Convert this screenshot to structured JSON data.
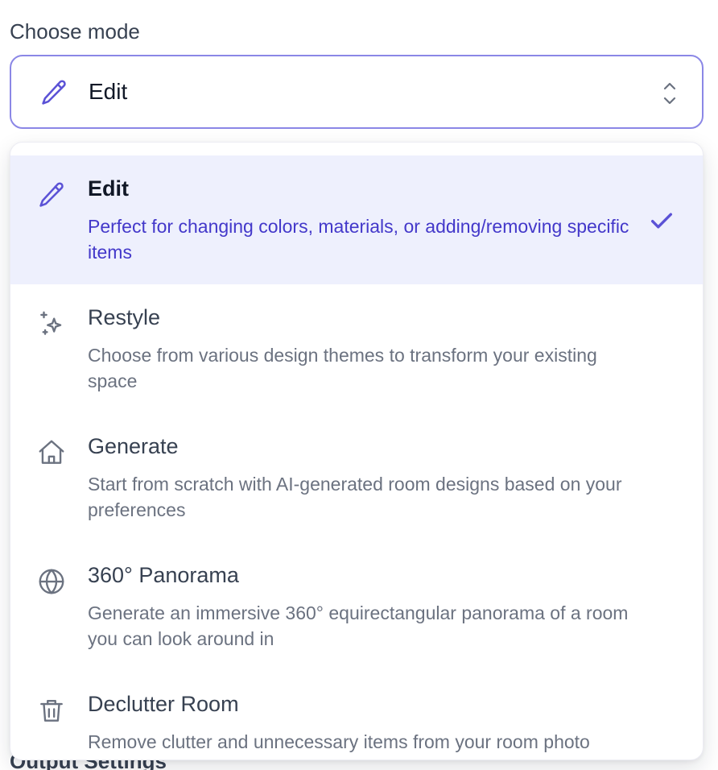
{
  "section_label": "Choose mode",
  "select": {
    "value": "Edit",
    "icon": "pencil-icon"
  },
  "options": [
    {
      "title": "Edit",
      "description": "Perfect for changing colors, materials, or adding/removing specific items",
      "icon": "pencil-icon",
      "selected": true
    },
    {
      "title": "Restyle",
      "description": "Choose from various design themes to transform your existing space",
      "icon": "sparkles-icon",
      "selected": false
    },
    {
      "title": "Generate",
      "description": "Start from scratch with AI-generated room designs based on your preferences",
      "icon": "home-icon",
      "selected": false
    },
    {
      "title": "360° Panorama",
      "description": "Generate an immersive 360° equirectangular panorama of a room you can look around in",
      "icon": "globe-icon",
      "selected": false
    },
    {
      "title": "Declutter Room",
      "description": "Remove clutter and unnecessary items from your room photo",
      "icon": "trash-icon",
      "selected": false
    }
  ],
  "background_label": "Output Settings",
  "colors": {
    "accent": "#5b52d6",
    "selected_bg": "#eef0fd",
    "border": "#8b87e6"
  }
}
